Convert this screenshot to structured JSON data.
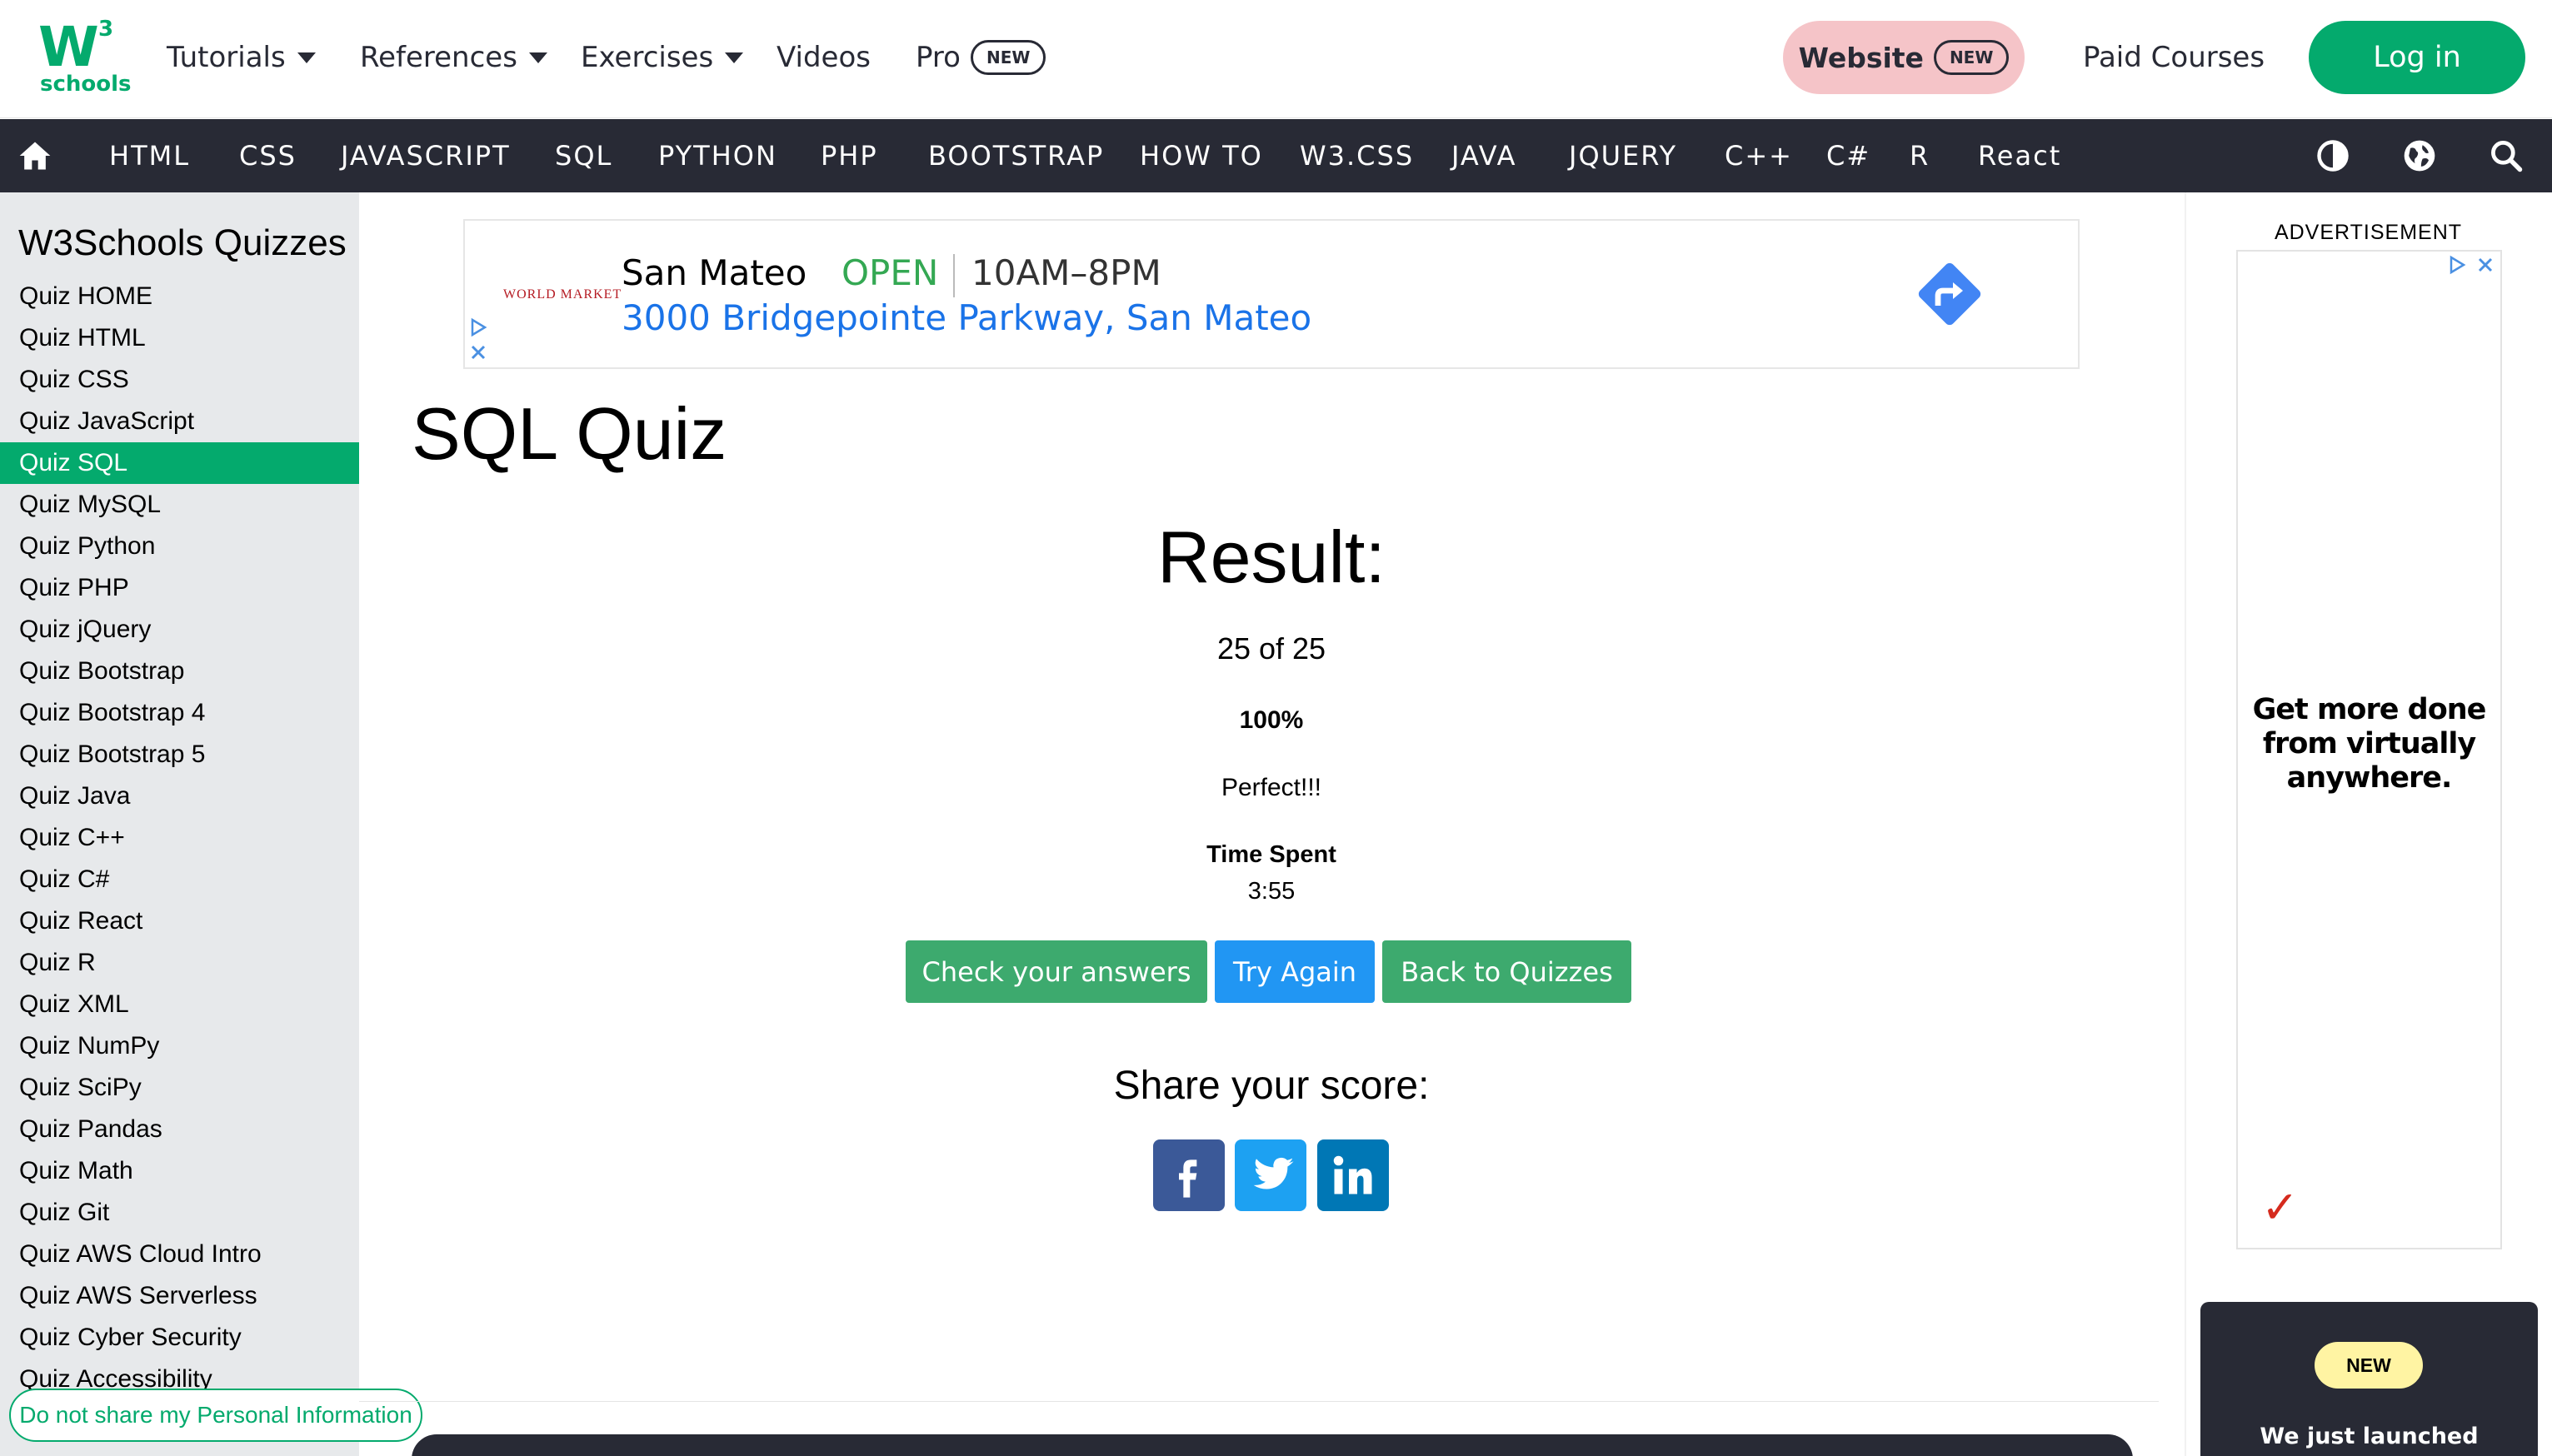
{
  "logo": {
    "mark": "W",
    "superscript": "3",
    "word": "schools"
  },
  "topnav": {
    "tutorials": "Tutorials",
    "references": "References",
    "exercises": "Exercises",
    "videos": "Videos",
    "pro": "Pro",
    "pro_badge": "NEW",
    "website": "Website",
    "website_badge": "NEW",
    "paid_courses": "Paid Courses",
    "login": "Log in"
  },
  "darknav": {
    "links": [
      "HTML",
      "CSS",
      "JAVASCRIPT",
      "SQL",
      "PYTHON",
      "PHP",
      "BOOTSTRAP",
      "HOW TO",
      "W3.CSS",
      "JAVA",
      "JQUERY",
      "C++",
      "C#",
      "R",
      "React"
    ],
    "icons": [
      "home-icon",
      "contrast-icon",
      "globe-icon",
      "search-icon"
    ]
  },
  "sidebar": {
    "heading": "W3Schools Quizzes",
    "active_item": "Quiz SQL",
    "items": [
      "Quiz HOME",
      "Quiz HTML",
      "Quiz CSS",
      "Quiz JavaScript",
      "Quiz SQL",
      "Quiz MySQL",
      "Quiz Python",
      "Quiz PHP",
      "Quiz jQuery",
      "Quiz Bootstrap",
      "Quiz Bootstrap 4",
      "Quiz Bootstrap 5",
      "Quiz Java",
      "Quiz C++",
      "Quiz C#",
      "Quiz React",
      "Quiz R",
      "Quiz XML",
      "Quiz NumPy",
      "Quiz SciPy",
      "Quiz Pandas",
      "Quiz Math",
      "Quiz Git",
      "Quiz AWS Cloud Intro",
      "Quiz AWS Serverless",
      "Quiz Cyber Security",
      "Quiz Accessibility"
    ]
  },
  "privacy_link": "Do not share my Personal Information",
  "top_ad": {
    "brand": "WORLD MARKET",
    "city": "San Mateo",
    "status": "OPEN",
    "hours": "10AM–8PM",
    "address": "3000 Bridgepointe Parkway, San Mateo"
  },
  "main": {
    "title": "SQL Quiz",
    "result_heading": "Result:",
    "score": "25 of 25",
    "percent": "100%",
    "verdict": "Perfect!!!",
    "time_label": "Time Spent",
    "time_value": "3:55",
    "buttons": {
      "check": "Check your answers",
      "retry": "Try Again",
      "back": "Back to Quizzes"
    },
    "share_heading": "Share your score:",
    "share_icons": [
      "facebook-icon",
      "twitter-icon",
      "linkedin-icon"
    ]
  },
  "right_column": {
    "ad_label": "ADVERTISEMENT",
    "ad_text": "Get more done from virtually anywhere.",
    "ad_logo": "✓",
    "promo_badge": "NEW",
    "promo_text": "We just launched"
  },
  "colors": {
    "brand_green": "#04aa6d",
    "nav_dark": "#282a35",
    "sidebar_bg": "#e7e9eb",
    "try_again_blue": "#2196f3",
    "website_pink": "#f5c4c8",
    "facebook": "#3b5998",
    "twitter": "#1da1f2",
    "linkedin": "#0077b5"
  }
}
